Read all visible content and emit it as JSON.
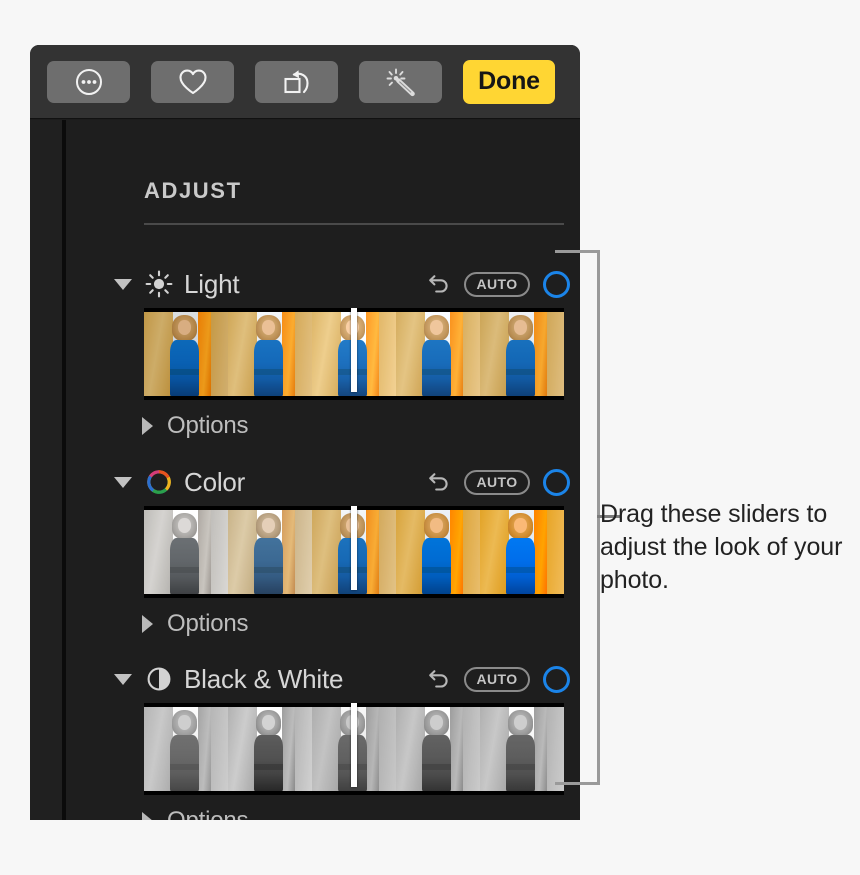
{
  "toolbar": {
    "buttons": [
      {
        "name": "more-options-button",
        "icon": "circle-ellipsis-icon",
        "label": ""
      },
      {
        "name": "favorite-button",
        "icon": "heart-icon",
        "label": ""
      },
      {
        "name": "rotate-button",
        "icon": "rotate-counterclockwise-icon",
        "label": ""
      },
      {
        "name": "auto-enhance-button",
        "icon": "magic-wand-icon",
        "label": ""
      }
    ],
    "done_label": "Done",
    "done_color": "#ffd633"
  },
  "panel": {
    "header": "ADJUST",
    "background": "#1e1e1e"
  },
  "sections": [
    {
      "id": "light",
      "label": "Light",
      "icon": "sun-icon",
      "expanded_triangle": "triangle-down",
      "revert_label": "",
      "auto_label": "AUTO",
      "toggle_color": "#1b84e8",
      "slider_position_pct": 50,
      "options_label": "Options",
      "options_triangle": "triangle-right",
      "filmstrip": {
        "frames": 5,
        "description": "Light exposure preview thumbnails, darker to brighter",
        "tones": [
          "brightness(0.92) saturate(1.25)",
          "brightness(1.02) saturate(1.1)",
          "brightness(1.10) saturate(1.0)",
          "brightness(1.05) saturate(1.05)",
          "brightness(1.00) saturate(1.1)"
        ]
      }
    },
    {
      "id": "color",
      "label": "Color",
      "icon": "color-wheel-icon",
      "expanded_triangle": "triangle-down",
      "revert_label": "",
      "auto_label": "AUTO",
      "toggle_color": "#1b84e8",
      "slider_position_pct": 50,
      "options_label": "Options",
      "options_triangle": "triangle-right",
      "filmstrip": {
        "frames": 5,
        "description": "Saturation preview thumbnails, grayscale to vivid",
        "tones": [
          "saturate(0.05) brightness(1.12)",
          "saturate(0.55) brightness(1.08)",
          "saturate(1.05) brightness(1.02)",
          "saturate(1.45) brightness(1.0)",
          "saturate(1.75) brightness(1.0)"
        ]
      }
    },
    {
      "id": "black-and-white",
      "label": "Black & White",
      "icon": "contrast-circle-icon",
      "expanded_triangle": "triangle-down",
      "revert_label": "",
      "auto_label": "AUTO",
      "toggle_color": "#1b84e8",
      "slider_position_pct": 50,
      "options_label": "Options",
      "options_triangle": "triangle-right",
      "filmstrip": {
        "frames": 5,
        "description": "Black and white preview thumbnails, varying contrast",
        "tones": [
          "grayscale(1) contrast(0.9) brightness(1.1)",
          "grayscale(1) contrast(1.25) brightness(1.0)",
          "grayscale(1) contrast(0.95) brightness(1.05)",
          "grayscale(1) contrast(1.1) brightness(1.02)",
          "grayscale(1) contrast(1.05) brightness(1.04)"
        ]
      }
    }
  ],
  "annotation": {
    "text": "Drag these sliders to adjust the look of your photo.",
    "line_color": "#9a9a9a"
  }
}
